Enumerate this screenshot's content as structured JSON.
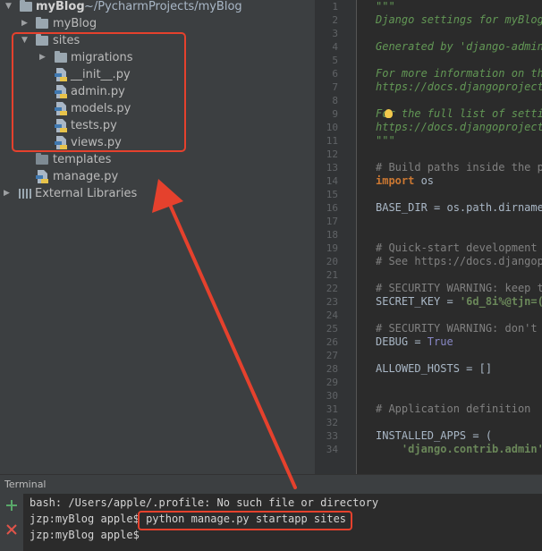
{
  "project_tree": {
    "root": {
      "name": "myBlog",
      "path": "~/PycharmProjects/myBlog"
    },
    "items": [
      {
        "label": "myBlog"
      },
      {
        "label": "sites"
      },
      {
        "label": "migrations"
      },
      {
        "label": "__init__.py"
      },
      {
        "label": "admin.py"
      },
      {
        "label": "models.py"
      },
      {
        "label": "tests.py"
      },
      {
        "label": "views.py"
      },
      {
        "label": "templates"
      },
      {
        "label": "manage.py"
      },
      {
        "label": "External Libraries"
      }
    ]
  },
  "editor": {
    "line_numbers": [
      "1",
      "2",
      "3",
      "4",
      "5",
      "6",
      "7",
      "8",
      "9",
      "10",
      "11",
      "12",
      "13",
      "14",
      "15",
      "16",
      "17",
      "18",
      "19",
      "20",
      "21",
      "22",
      "23",
      "24",
      "25",
      "26",
      "27",
      "28",
      "29",
      "30",
      "31",
      "32",
      "33",
      "34"
    ],
    "lines": [
      "\"\"\"",
      "Django settings for myBlog",
      "",
      "Generated by 'django-admin",
      "",
      "For more information on thi",
      "https://docs.djangoproject.",
      "",
      "For the full list of settin",
      "https://docs.djangoproject.",
      "\"\"\"",
      "",
      "# Build paths inside the pr",
      "import",
      " os",
      "BASE_DIR = os.path.dirname(",
      "# Quick-start development s",
      "# See https://docs.djangopr",
      "# SECURITY WARNING: keep th",
      "SECRET_KEY = ",
      "'6d_8i%@tjn=(",
      "# SECURITY WARNING: don't r",
      "DEBUG = ",
      "True",
      "ALLOWED_HOSTS = []",
      "# Application definition",
      "INSTALLED_APPS = (",
      "    ",
      "'django.contrib.admin',"
    ]
  },
  "terminal": {
    "title": "Terminal",
    "line1": "bash: /Users/apple/.profile: No such file or directory",
    "prompt": "jzp:myBlog apple$",
    "command": "python manage.py startapp sites",
    "prompt2": "jzp:myBlog apple$"
  },
  "colors": {
    "annotation": "#e5412d",
    "add": "#59a869",
    "close": "#e0544a"
  }
}
